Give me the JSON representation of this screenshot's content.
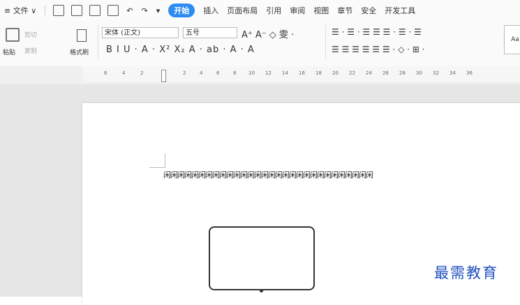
{
  "menubar": {
    "file": "≡ 文件 ∨",
    "tabs": [
      "开始",
      "插入",
      "页面布局",
      "引用",
      "审阅",
      "视图",
      "章节",
      "安全",
      "开发工具"
    ],
    "active_tab": "开始"
  },
  "ribbon": {
    "paste": "粘贴",
    "cut": "剪切",
    "copy": "复制",
    "format_painter": "格式刷",
    "font_name": "宋体 (正文)",
    "font_size": "五号",
    "format_row": "B I U · A · X² X₂ A · ab · A · A",
    "size_row": "A⁺ A⁻ ◇ 雯 ·",
    "para_row1": "☰ · ☰ · ☰ ☰ ☰ · ☰ · ☰",
    "para_row2": "☰ ☰ ☰ ☰ ☰ ☰ · ◇ · ⊞ ·",
    "style_label": "Aa"
  },
  "ruler": {
    "ticks": [
      "6",
      "4",
      "2",
      "2",
      "4",
      "6",
      "8",
      "10",
      "12",
      "14",
      "16",
      "18",
      "20",
      "22",
      "24",
      "26",
      "28",
      "30",
      "32",
      "34",
      "36"
    ]
  },
  "document": {
    "text": "闲闲闲闲闲闲闲闲闲闲闲闲闲闲闲闲闲闲闲闲闲闲闲闲闲闲闲闲闲闲"
  },
  "watermark": "最需教育"
}
